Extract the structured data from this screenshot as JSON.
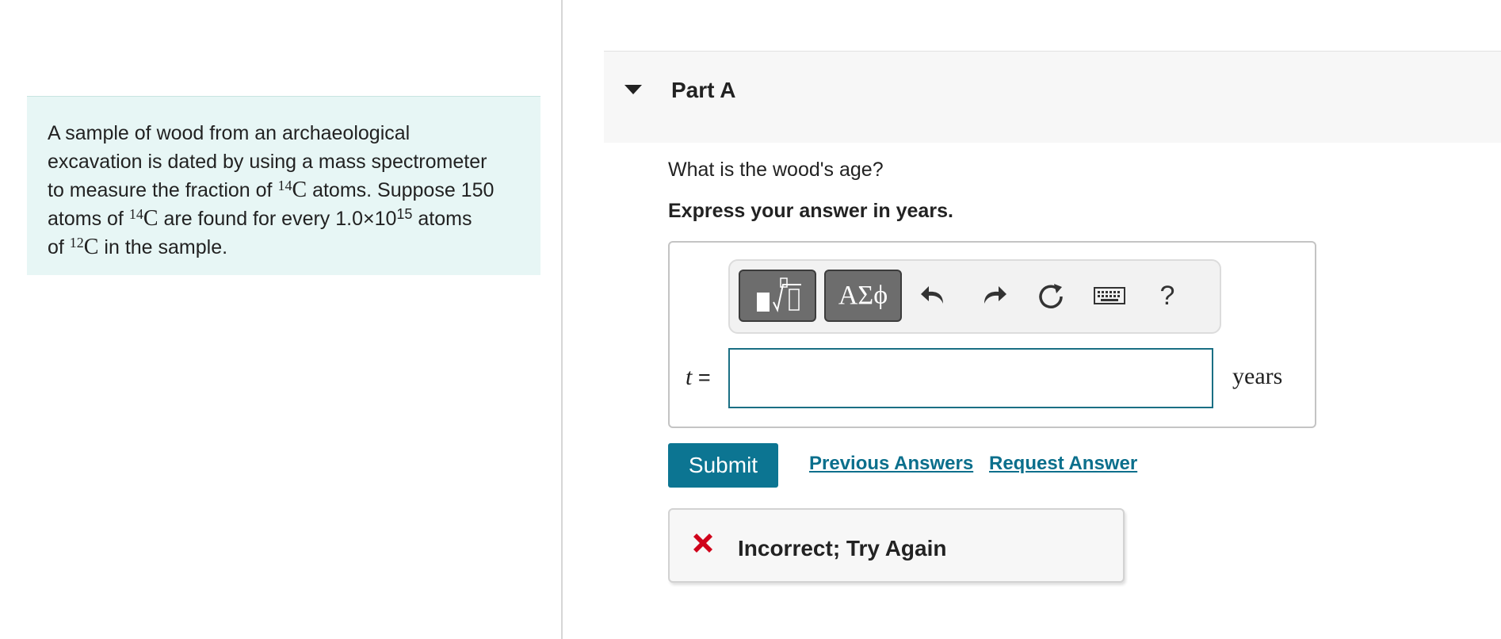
{
  "problem": {
    "line1": "A sample of wood from an archaeological",
    "line2": "excavation is dated by using a mass spectrometer",
    "line3_pre": "to measure the fraction of ",
    "line3_sup": "14",
    "line3_elem": "C",
    "line3_post": " atoms. Suppose 150",
    "line4_pre": "atoms of ",
    "line4_sup": "14",
    "line4_elem": "C",
    "line4_mid": " are found for every 1.0×10",
    "line4_exp": "15",
    "line4_post": " atoms",
    "line5_pre": "of ",
    "line5_sup": "12",
    "line5_elem": "C",
    "line5_post": " in the sample."
  },
  "part": {
    "title": "Part A"
  },
  "question": "What is the wood's age?",
  "instruction": "Express your answer in years.",
  "answer": {
    "variable": "t",
    "equals": " =",
    "value": "",
    "unit": "years"
  },
  "toolbar": {
    "symbols_label": "ΑΣϕ",
    "help_label": "?",
    "icons": [
      "templates-icon",
      "symbols-icon",
      "undo-icon",
      "redo-icon",
      "reset-icon",
      "keyboard-icon",
      "help-icon"
    ]
  },
  "actions": {
    "submit_label": "Submit",
    "previous_answers_label": "Previous Answers",
    "request_answer_label": "Request Answer"
  },
  "feedback": {
    "text": "Incorrect; Try Again",
    "icon": "x-icon",
    "color": "#d0021b"
  },
  "colors": {
    "accent": "#0c7592",
    "problem_bg": "#e7f6f5"
  }
}
